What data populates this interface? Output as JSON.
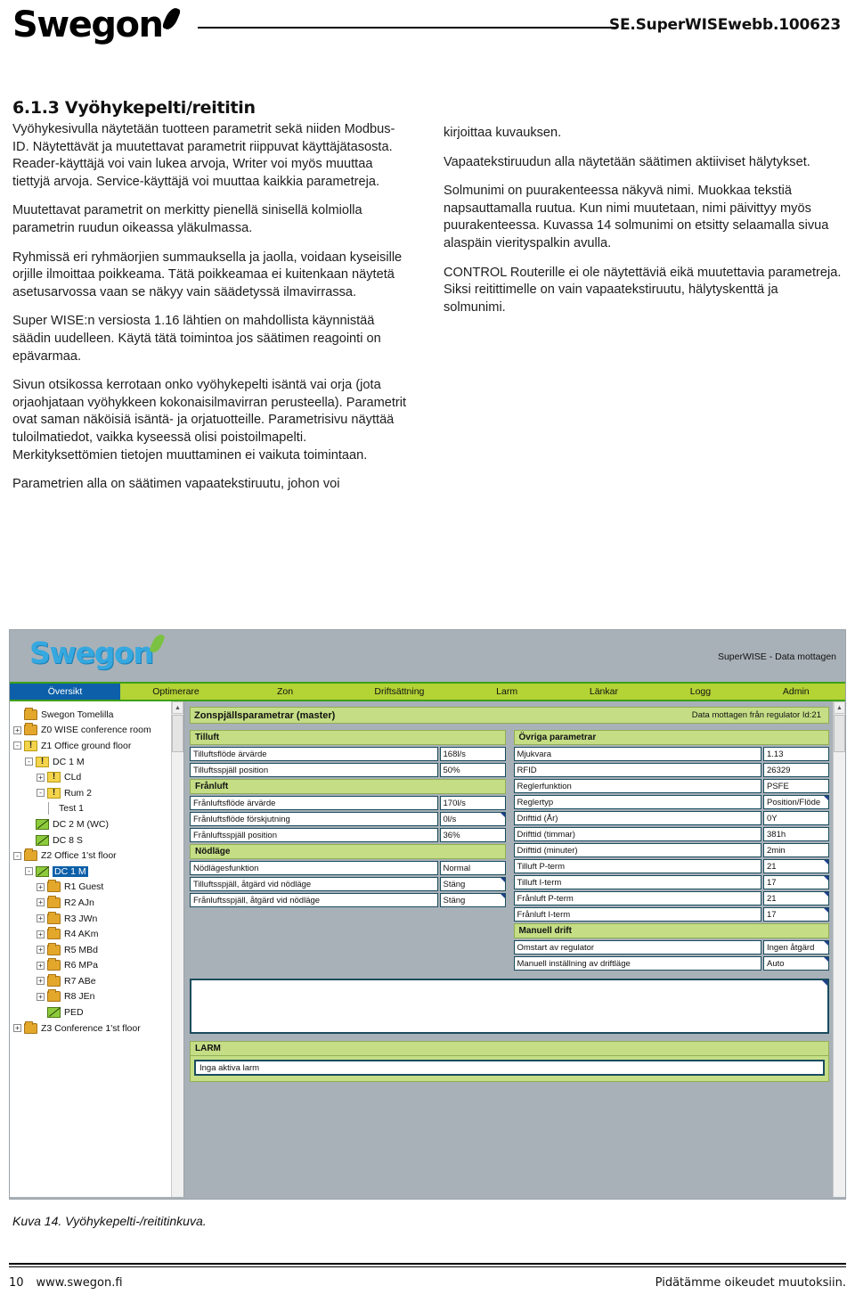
{
  "header": {
    "logo_text": "Swegon",
    "doc_code": "SE.SuperWISEwebb.100623"
  },
  "content": {
    "section_number_title": "6.1.3 Vyöhykepelti/reititin",
    "left_paragraphs": [
      "Vyöhykesivulla näytetään tuotteen parametrit sekä niiden Modbus-ID. Näytettävät ja muutettavat parametrit riippuvat käyttäjätasosta. Reader-käyttäjä voi vain lukea arvoja, Writer voi myös muuttaa tiettyjä arvoja. Service-käyttäjä voi muuttaa kaikkia parametreja.",
      "Muutettavat parametrit on merkitty pienellä sinisellä kolmiolla parametrin ruudun oikeassa yläkulmassa.",
      "Ryhmissä eri ryhmäorjien summauksella ja jaolla, voidaan kyseisille orjille ilmoittaa poikkeama. Tätä poikkeamaa ei kuitenkaan näytetä asetusarvossa vaan se näkyy vain säädetyssä ilmavirrassa.",
      "Super WISE:n versiosta 1.16 lähtien on mahdollista käynnistää säädin uudelleen. Käytä tätä toimintoa jos säätimen reagointi on epävarmaa.",
      "Sivun otsikossa kerrotaan onko vyöhykepelti isäntä vai orja (jota orjaohjataan vyöhykkeen kokonaisilmavirran perusteella). Parametrit ovat saman näköisiä isäntä- ja orjatuotteille. Parametrisivu näyttää tuloilmatiedot, vaikka kyseessä olisi poistoilmapelti. Merkityksettömien tietojen muuttaminen ei vaikuta toimintaan.",
      "Parametrien alla on säätimen vapaatekstiruutu, johon voi"
    ],
    "right_paragraphs": [
      "kirjoittaa kuvauksen.",
      "Vapaatekstiruudun alla näytetään säätimen aktiiviset hälytykset.",
      "Solmunimi on puurakenteessa näkyvä nimi. Muokkaa tekstiä napsauttamalla ruutua. Kun nimi muutetaan, nimi päivittyy myös puurakenteessa. Kuvassa 14 solmunimi on etsitty selaamalla sivua alaspäin vierityspalkin avulla.",
      "CONTROL Routerille ei ole näytettäviä eikä muutettavia parametreja. Siksi reitittimelle on vain vapaatekstiruutu, hälytyskenttä ja solmunimi."
    ]
  },
  "app": {
    "logo_text": "Swegon",
    "status_text": "SuperWISE - Data mottagen",
    "tabs": [
      {
        "label": "Översikt",
        "active": true
      },
      {
        "label": "Optimerare",
        "active": false
      },
      {
        "label": "Zon",
        "active": false
      },
      {
        "label": "Driftsättning",
        "active": false
      },
      {
        "label": "Larm",
        "active": false
      },
      {
        "label": "Länkar",
        "active": false
      },
      {
        "label": "Logg",
        "active": false
      },
      {
        "label": "Admin",
        "active": false
      }
    ],
    "tree": [
      {
        "label": "Swegon Tomelilla",
        "indent": 0,
        "toggle": "",
        "icon": "folder",
        "selected": false
      },
      {
        "label": "Z0 WISE conference room",
        "indent": 0,
        "toggle": "+",
        "icon": "folder",
        "selected": false
      },
      {
        "label": "Z1 Office ground floor",
        "indent": 0,
        "toggle": "-",
        "icon": "warn",
        "selected": false
      },
      {
        "label": "DC 1 M",
        "indent": 1,
        "toggle": "-",
        "icon": "warn",
        "selected": false
      },
      {
        "label": "CLd",
        "indent": 2,
        "toggle": "+",
        "icon": "warn",
        "selected": false
      },
      {
        "label": "Rum 2",
        "indent": 2,
        "toggle": "-",
        "icon": "warn",
        "selected": false
      },
      {
        "label": "Test 1",
        "indent": 3,
        "toggle": "",
        "icon": "leaf",
        "selected": false
      },
      {
        "label": "DC 2 M (WC)",
        "indent": 1,
        "toggle": "",
        "icon": "damper",
        "selected": false
      },
      {
        "label": "DC 8 S",
        "indent": 1,
        "toggle": "",
        "icon": "damper",
        "selected": false
      },
      {
        "label": "Z2 Office 1'st floor",
        "indent": 0,
        "toggle": "-",
        "icon": "folder",
        "selected": false
      },
      {
        "label": "DC 1 M",
        "indent": 1,
        "toggle": "-",
        "icon": "damper",
        "selected": true
      },
      {
        "label": "R1 Guest",
        "indent": 2,
        "toggle": "+",
        "icon": "folder",
        "selected": false
      },
      {
        "label": "R2 AJn",
        "indent": 2,
        "toggle": "+",
        "icon": "folder",
        "selected": false
      },
      {
        "label": "R3 JWn",
        "indent": 2,
        "toggle": "+",
        "icon": "folder",
        "selected": false
      },
      {
        "label": "R4 AKm",
        "indent": 2,
        "toggle": "+",
        "icon": "folder",
        "selected": false
      },
      {
        "label": "R5 MBd",
        "indent": 2,
        "toggle": "+",
        "icon": "folder",
        "selected": false
      },
      {
        "label": "R6 MPa",
        "indent": 2,
        "toggle": "+",
        "icon": "folder",
        "selected": false
      },
      {
        "label": "R7 ABe",
        "indent": 2,
        "toggle": "+",
        "icon": "folder",
        "selected": false
      },
      {
        "label": "R8 JEn",
        "indent": 2,
        "toggle": "+",
        "icon": "folder",
        "selected": false
      },
      {
        "label": "PED",
        "indent": 2,
        "toggle": "",
        "icon": "damper",
        "selected": false
      },
      {
        "label": "Z3 Conference 1'st floor",
        "indent": 0,
        "toggle": "+",
        "icon": "folder",
        "selected": false
      }
    ],
    "panel": {
      "title": "Zonspjällsparametrar (master)",
      "status": "Data mottagen från regulator Id:21"
    },
    "groups_left": [
      {
        "title": "Tilluft",
        "rows": [
          {
            "name": "Tilluftsflöde ärvärde",
            "value": "168l/s",
            "editable": false
          },
          {
            "name": "Tilluftsspjäll position",
            "value": "50%",
            "editable": false
          }
        ]
      },
      {
        "title": "Frånluft",
        "rows": [
          {
            "name": "Frånluftsflöde ärvärde",
            "value": "170l/s",
            "editable": false
          },
          {
            "name": "Frånluftsflöde förskjutning",
            "value": "0l/s",
            "editable": true
          },
          {
            "name": "Frånluftsspjäll position",
            "value": "36%",
            "editable": false
          }
        ]
      },
      {
        "title": "Nödläge",
        "rows": [
          {
            "name": "Nödlägesfunktion",
            "value": "Normal",
            "editable": false
          },
          {
            "name": "Tilluftsspjäll, åtgärd vid nödläge",
            "value": "Stäng",
            "editable": true
          },
          {
            "name": "Frånluftsspjäll, åtgärd vid nödläge",
            "value": "Stäng",
            "editable": true
          }
        ]
      }
    ],
    "groups_right": [
      {
        "title": "Övriga parametrar",
        "rows": [
          {
            "name": "Mjukvara",
            "value": "1.13",
            "editable": false
          },
          {
            "name": "RFID",
            "value": "26329",
            "editable": false
          },
          {
            "name": "Reglerfunktion",
            "value": "PSFE",
            "editable": false
          },
          {
            "name": "Reglertyp",
            "value": "Position/Flöde",
            "editable": true
          },
          {
            "name": "Drifttid (År)",
            "value": "0Y",
            "editable": false
          },
          {
            "name": "Drifttid (timmar)",
            "value": "381h",
            "editable": false
          },
          {
            "name": "Drifttid (minuter)",
            "value": "2min",
            "editable": false
          },
          {
            "name": "Tilluft P-term",
            "value": "21",
            "editable": true
          },
          {
            "name": "Tilluft I-term",
            "value": "17",
            "editable": true
          },
          {
            "name": "Frånluft P-term",
            "value": "21",
            "editable": true
          },
          {
            "name": "Frånluft I-term",
            "value": "17",
            "editable": true
          }
        ]
      },
      {
        "title": "Manuell drift",
        "rows": [
          {
            "name": "Omstart av regulator",
            "value": "Ingen åtgärd",
            "editable": true
          },
          {
            "name": "Manuell inställning av driftläge",
            "value": "Auto",
            "editable": true
          }
        ]
      }
    ],
    "freetext_value": "",
    "larm": {
      "title": "LARM",
      "message": "Inga aktiva larm"
    }
  },
  "caption": "Kuva 14. Vyöhykepelti-/reititinkuva.",
  "footer": {
    "page_number": "10",
    "website": "www.swegon.fi",
    "disclaimer": "Pidätämme oikeudet muutoksiin."
  }
}
